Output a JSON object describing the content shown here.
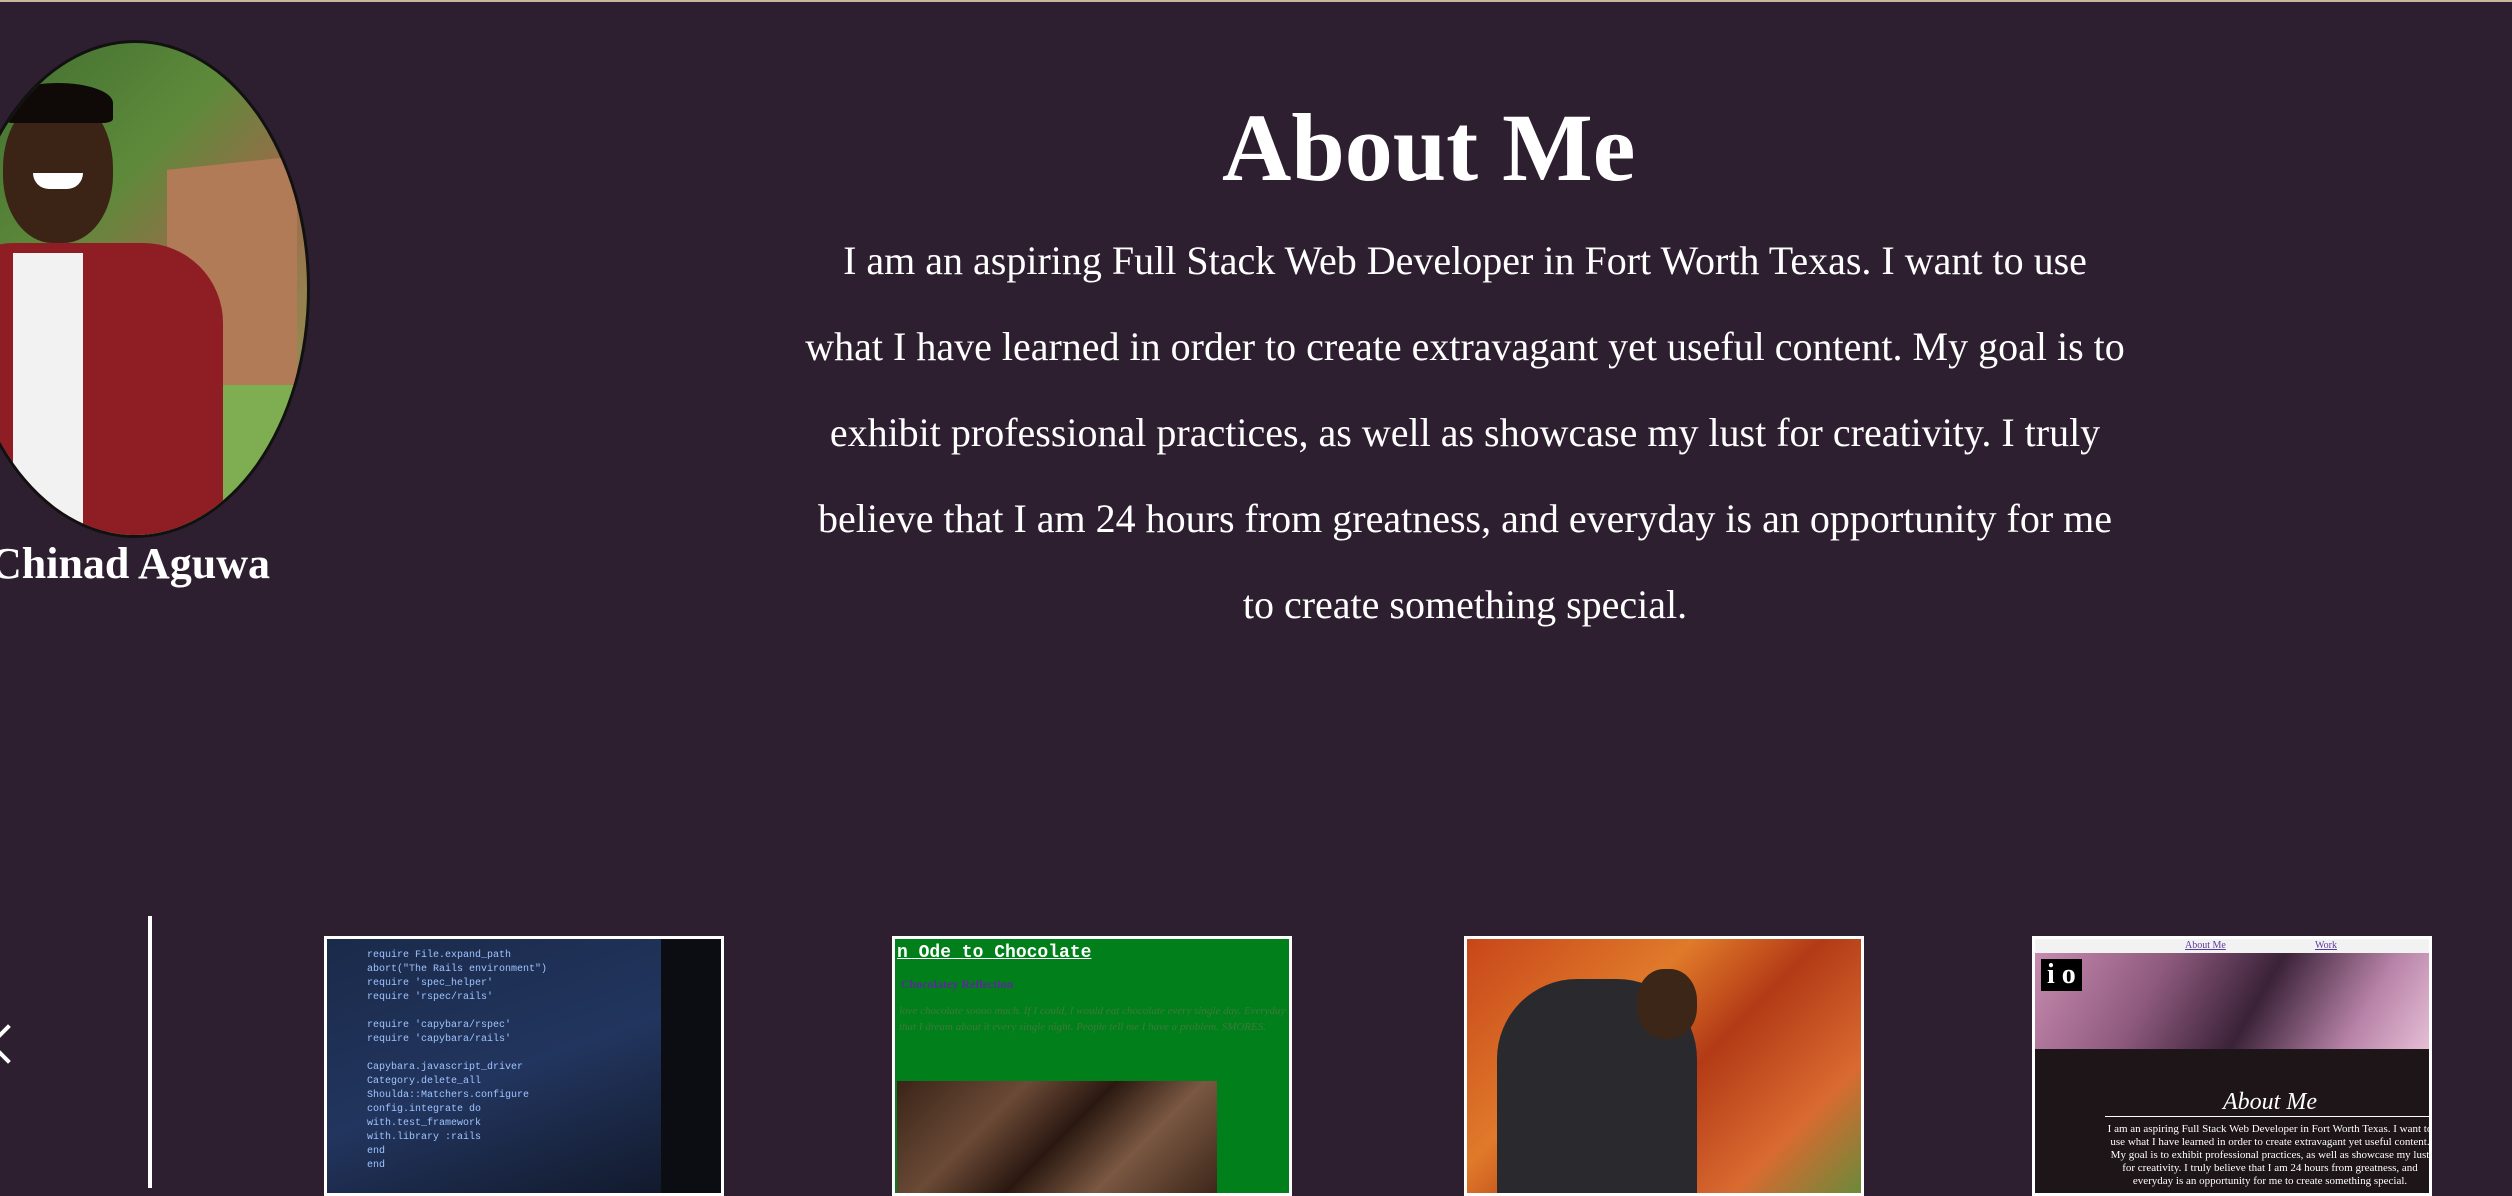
{
  "profile": {
    "name": "Chinad Aguwa"
  },
  "about": {
    "title": "About Me",
    "text": "I am an aspiring Full Stack Web Developer in Fort Worth Texas. I want to use what I have learned in order to create extravagant yet useful content. My goal is to exhibit professional practices, as well as showcase my lust for creativity. I truly believe that I am 24 hours from greatness, and everyday is an opportunity for me to create something special."
  },
  "carousel": {
    "prev_icon": "chevron-left-icon",
    "items": [
      {
        "kind": "code-screenshot"
      },
      {
        "kind": "ode-to-chocolate",
        "title": "n Ode to Chocolate",
        "subtitle": "Chocolatey Reflection",
        "quote": "love chocolate soooo much. If I could, I would eat chocolate every single day. Everyday that I dream about it every single night. People tell me I have a problem. SMORES."
      },
      {
        "kind": "portrait-photo"
      },
      {
        "kind": "portfolio-preview",
        "nav": [
          "About Me",
          "Work"
        ],
        "logo": "i o",
        "heading": "About Me",
        "text": "I am an aspiring Full Stack Web Developer in Fort Worth Texas. I want to use what I have learned in order to create extravagant yet useful content. My goal is to exhibit professional practices, as well as showcase my lust for creativity. I truly believe that I am 24 hours from greatness, and everyday is an opportunity for me to create something special."
      }
    ]
  },
  "colors": {
    "background": "#2e1f30",
    "text": "#ffffff",
    "accent_green": "#007f1a"
  }
}
